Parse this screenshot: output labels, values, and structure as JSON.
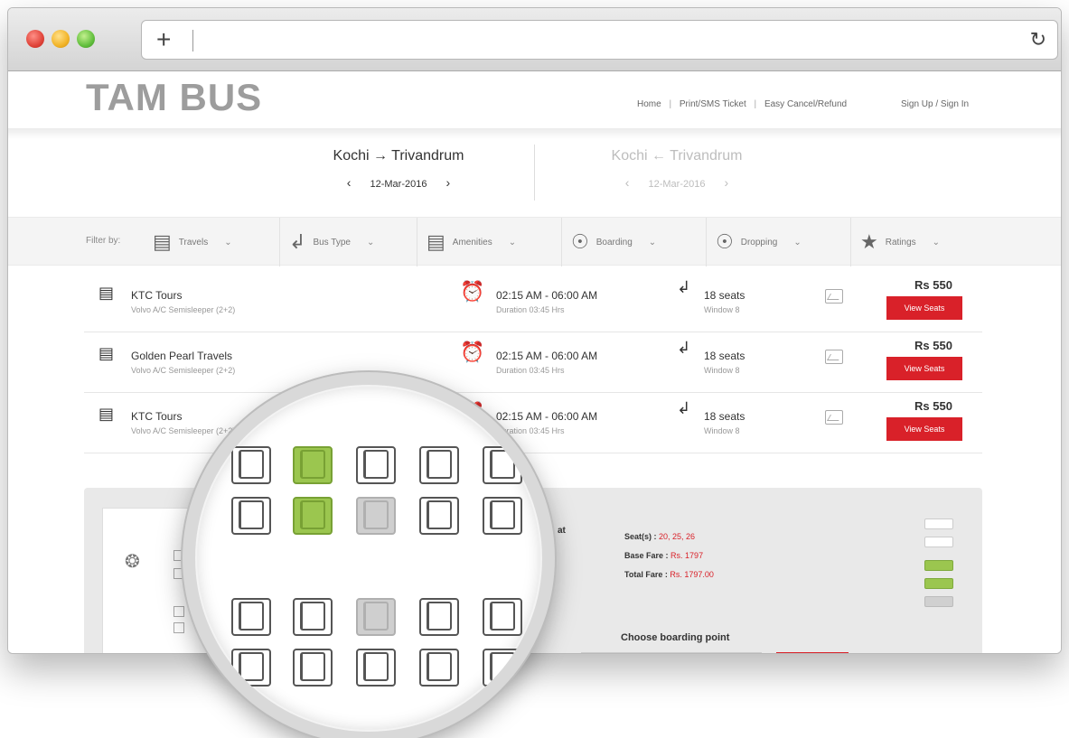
{
  "site": {
    "logo": "TAM BUS",
    "nav": [
      "Home",
      "Print/SMS Ticket",
      "Easy Cancel/Refund"
    ],
    "nav_separator": "|",
    "signin": "Sign Up / Sign In"
  },
  "route": {
    "forward": {
      "from": "Kochi",
      "to": "Trivandrum",
      "arrow": "→",
      "date": "12-Mar-2016"
    },
    "return": {
      "from": "Kochi",
      "to": "Trivandrum",
      "arrow": "←",
      "date": "12-Mar-2016"
    }
  },
  "filters": {
    "label": "Filter by:",
    "items": [
      {
        "label": "Travels",
        "icon": "bus-icon"
      },
      {
        "label": "Bus Type",
        "icon": "seat-icon"
      },
      {
        "label": "Amenities",
        "icon": "bus-icon"
      },
      {
        "label": "Boarding",
        "icon": "location-pin-icon"
      },
      {
        "label": "Dropping",
        "icon": "location-pin-icon"
      },
      {
        "label": "Ratings",
        "icon": "star-icon"
      }
    ]
  },
  "buses": [
    {
      "name": "KTC Tours",
      "type": "Volvo A/C Semisleeper (2+2)",
      "time": "02:15 AM - 06:00 AM",
      "duration": "Duration 03:45 Hrs",
      "seats": "18 seats",
      "window": "Window 8",
      "price": "Rs 550",
      "button": "View Seats"
    },
    {
      "name": "Golden Pearl Travels",
      "type": "Volvo A/C Semisleeper (2+2)",
      "time": "02:15 AM - 06:00 AM",
      "duration": "Duration 03:45 Hrs",
      "seats": "18 seats",
      "window": "Window 8",
      "price": "Rs 550",
      "button": "View Seats"
    },
    {
      "name": "KTC Tours",
      "type": "Volvo A/C Semisleeper (2+2)",
      "time": "02:15 AM - 06:00 AM",
      "duration": "Duration 03:45 Hrs",
      "seats": "18 seats",
      "window": "Window 8",
      "price": "Rs 550",
      "button": "View Seats"
    }
  ],
  "booking": {
    "seats_label": "Seat(s) :",
    "seats_value": "20, 25, 26",
    "base_label": "Base Fare :",
    "base_value": "Rs. 1797",
    "total_label": "Total Fare :",
    "total_value": "Rs. 1797.00",
    "boarding_label": "Choose boarding point",
    "partial_label": "at"
  },
  "colors": {
    "accent": "#d92129",
    "booked_seat": "#9bc64f",
    "blocked_seat": "#cfcfcf",
    "logo": "#9d9d9d"
  },
  "icons": {
    "reload": "↻",
    "add": "+",
    "chevron": "⌄"
  }
}
